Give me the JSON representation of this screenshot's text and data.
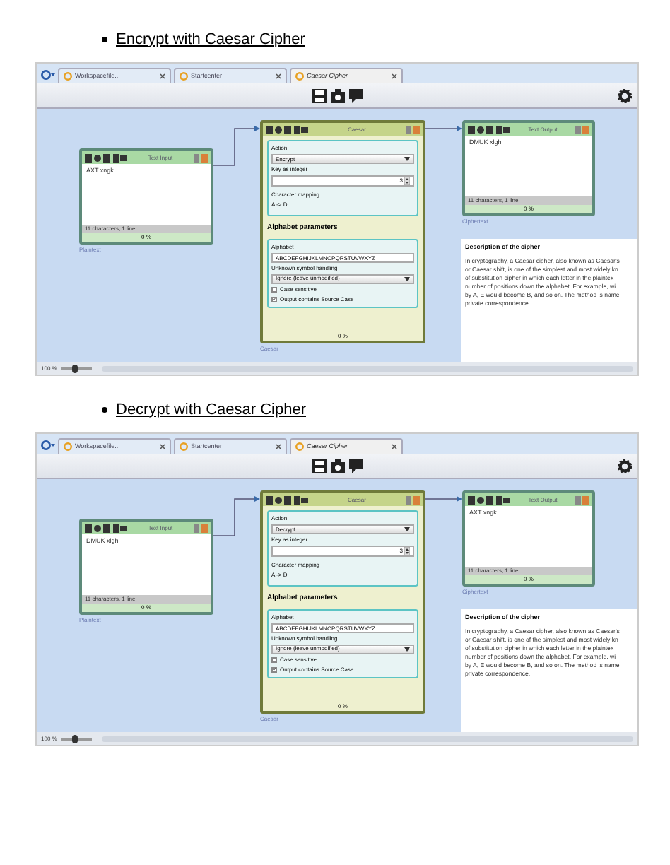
{
  "sections": [
    {
      "heading": "Encrypt with Caesar Cipher",
      "screenshot": {
        "tabs": [
          {
            "label": "Workspacefile...",
            "selected": false
          },
          {
            "label": "Startcenter",
            "selected": false
          },
          {
            "label": "Caesar Cipher",
            "selected": true
          }
        ],
        "input_node": {
          "header": "Text Input",
          "text": "AXT xngk",
          "status": "11 characters, 1 line",
          "progress": "0 %",
          "caption": "Plaintext"
        },
        "caesar_node": {
          "header": "Caesar",
          "action_label": "Action",
          "action": "Encrypt",
          "key_label": "Key as integer",
          "key": "3",
          "mapping_label": "Character mapping",
          "mapping": "A -> D",
          "alphabet_title": "Alphabet parameters",
          "alphabet_label": "Alphabet",
          "alphabet": "ABCDEFGHIJKLMNOPQRSTUVWXYZ",
          "unknown_label": "Unknown symbol handling",
          "unknown": "Ignore (leave unmodified)",
          "checkboxes": [
            {
              "label": "Case sensitive",
              "checked": false
            },
            {
              "label": "Output contains Source Case",
              "checked": true
            }
          ],
          "progress": "0 %",
          "caption": "Caesar"
        },
        "output_node": {
          "header": "Text Output",
          "text": "DMUK xlgh",
          "status": "11 characters, 1 line",
          "progress": "0 %",
          "caption": "Ciphertext"
        },
        "description": {
          "title": "Description of the cipher",
          "lines": [
            "In cryptography, a Caesar cipher, also known as Caesar's",
            "or Caesar shift, is one of the simplest and most widely kn",
            "of substitution cipher in which each letter in the plaintex",
            "number of positions down the alphabet. For example, wi",
            "by A, E would become B, and so on. The method is name",
            "private correspondence."
          ]
        },
        "zoom": "100 %",
        "zoom_slider": {
          "level": 0.45
        }
      }
    },
    {
      "heading": "Decrypt with Caesar Cipher",
      "screenshot": {
        "tabs": [
          {
            "label": "Workspacefile...",
            "selected": false
          },
          {
            "label": "Startcenter",
            "selected": false
          },
          {
            "label": "Caesar Cipher",
            "selected": true
          }
        ],
        "input_node": {
          "header": "Text Input",
          "text": "DMUK xlgh",
          "status": "11 characters, 1 line",
          "progress": "0 %",
          "caption": "Plaintext"
        },
        "caesar_node": {
          "header": "Caesar",
          "action_label": "Action",
          "action": "Decrypt",
          "key_label": "Key as integer",
          "key": "3",
          "mapping_label": "Character mapping",
          "mapping": "A -> D",
          "alphabet_title": "Alphabet parameters",
          "alphabet_label": "Alphabet",
          "alphabet": "ABCDEFGHIJKLMNOPQRSTUVWXYZ",
          "unknown_label": "Unknown symbol handling",
          "unknown": "Ignore (leave unmodified)",
          "checkboxes": [
            {
              "label": "Case sensitive",
              "checked": false
            },
            {
              "label": "Output contains Source Case",
              "checked": true
            }
          ],
          "progress": "0 %",
          "caption": "Caesar"
        },
        "output_node": {
          "header": "Text Output",
          "text": "AXT xngk",
          "status": "11 characters, 1 line",
          "progress": "0 %",
          "caption": "Ciphertext"
        },
        "description": {
          "title": "Description of the cipher",
          "lines": [
            "In cryptography, a Caesar cipher, also known as Caesar's",
            "or Caesar shift, is one of the simplest and most widely kn",
            "of substitution cipher in which each letter in the plaintex",
            "number of positions down the alphabet. For example, wi",
            "by A, E would become B, and so on. The method is name",
            "private correspondence."
          ]
        },
        "zoom": "100 %",
        "zoom_slider": {
          "level": 0.45
        }
      }
    }
  ]
}
